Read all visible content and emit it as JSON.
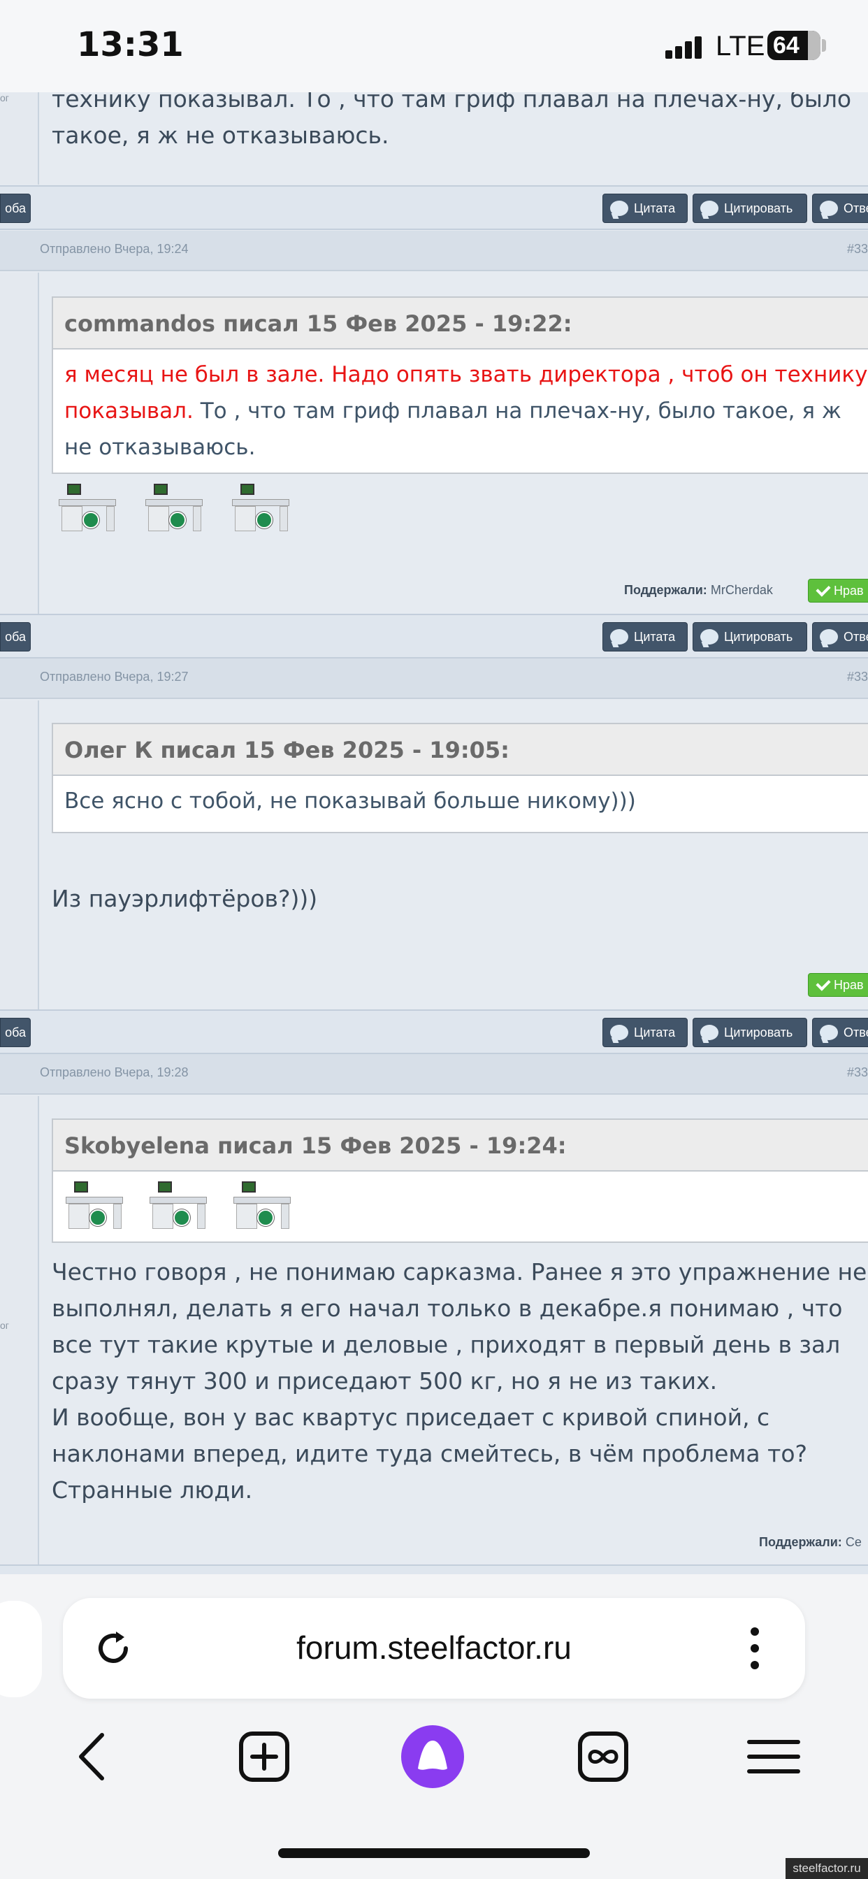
{
  "status_bar": {
    "time": "13:31",
    "network": "LTE",
    "battery": "64"
  },
  "buttons": {
    "left_stub": "оба",
    "quote": "Цитата",
    "cite": "Цитировать",
    "reply": "Отве",
    "like": "Нрав"
  },
  "top_post": {
    "side_fragment": "ог",
    "text_line1": "технику показывал. То , что там гриф плавал на плечах-ну, было",
    "text_line2": "такое, я ж не отказываюсь."
  },
  "posts": [
    {
      "date": "Отправлено Вчера, 19:24",
      "num": "#33",
      "quote_header": "commandos писал 15 Фев 2025 - 19:22:",
      "quote_red": "я месяц не был в зале. Надо опять звать директора , чтоб он технику показывал.",
      "quote_rest": " То , что там гриф плавал на плечах-ну, было такое, я ж не отказываюсь.",
      "supported_label": "Поддержали:",
      "supported_by": "MrCherdak"
    },
    {
      "date": "Отправлено Вчера, 19:27",
      "num": "#33",
      "quote_header": "Олег К писал 15 Фев 2025 - 19:05:",
      "quote_text": "Все ясно с тобой, не показывай больше никому)))",
      "text": "Из пауэрлифтёров?)))"
    },
    {
      "date": "Отправлено Вчера, 19:28",
      "num": "#33",
      "side_fragment": "ог",
      "quote_header": "Skobyelena писал 15 Фев 2025 - 19:24:",
      "lines": [
        "Честно говоря , не понимаю сарказма. Ранее я это упражнение не",
        "выполнял, делать я его начал только в декабре.я понимаю , что",
        "все тут такие крутые и деловые , приходят в первый день в зал",
        "сразу тянут 300 и приседают 500 кг, но я не из таких.",
        "И вообще, вон у вас квартус приседает с кривой спиной, с",
        "наклонами вперед, идите туда смейтесь, в чём проблема то?",
        "Странные люди."
      ],
      "supported_label": "Поддержали:",
      "supported_by": "Се"
    }
  ],
  "browser": {
    "url": "forum.steelfactor.ru"
  },
  "icons": [
    "reload-icon",
    "kebab-menu-icon",
    "back-icon",
    "new-tab-icon",
    "alice-assistant-icon",
    "tabs-icon",
    "menu-icon"
  ],
  "colors": {
    "accent_button": "#42556a",
    "like_green": "#5ec03c",
    "quote_red": "#e81414",
    "alice_purple": "#8a3cf0"
  },
  "watermark": "steelfactor.ru"
}
